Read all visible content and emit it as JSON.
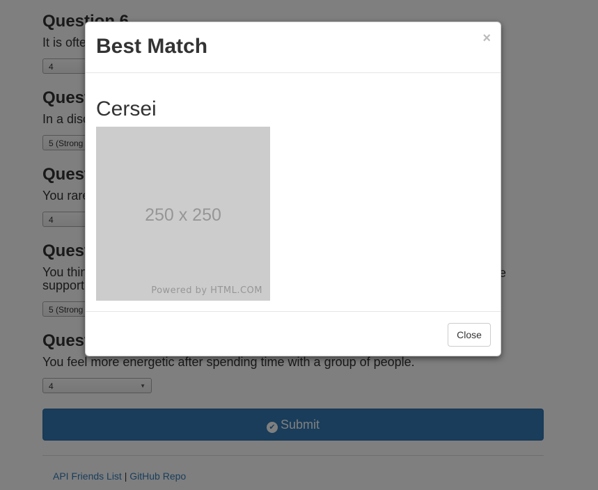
{
  "questions": [
    {
      "title": "Question 6",
      "text": "It is ofte",
      "value": "4"
    },
    {
      "title": "Quest",
      "text": "In a disc",
      "value": "5 (Strong"
    },
    {
      "title": "Quest",
      "text": "You rare",
      "value": "4"
    },
    {
      "title": "Quest",
      "text_line1": "You thin",
      "text_line2": "support",
      "text_tail": "e",
      "value": "5 (Strong"
    },
    {
      "title": "Quest",
      "text": "You feel more energetic after spending time with a group of people.",
      "value": "4"
    }
  ],
  "submit_label": "Submit",
  "footer": {
    "api_link": "API Friends List",
    "separator": "|",
    "github_link": "GitHub Repo"
  },
  "modal": {
    "title": "Best Match",
    "close_x": "×",
    "match_name": "Cersei",
    "placeholder_dims": "250 x 250",
    "placeholder_credit": "Powered by HTML.COM",
    "close_button": "Close"
  },
  "colors": {
    "primary": "#337ab7",
    "backdrop": "rgba(0,0,0,0.5)"
  }
}
